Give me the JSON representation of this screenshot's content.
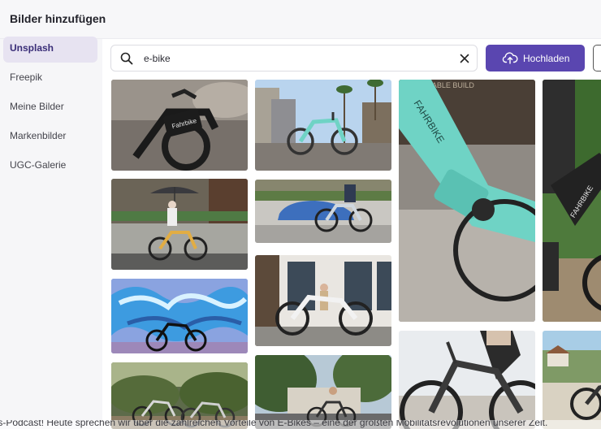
{
  "dialog": {
    "title": "Bilder hinzufügen"
  },
  "sidebar": {
    "items": [
      {
        "label": "Unsplash",
        "active": true
      },
      {
        "label": "Freepik"
      },
      {
        "label": "Meine Bilder"
      },
      {
        "label": "Markenbilder"
      },
      {
        "label": "UGC-Galerie"
      }
    ]
  },
  "search": {
    "value": "e-bike",
    "icon": "search-icon",
    "clear_icon": "close-icon"
  },
  "toolbar": {
    "upload_label": "Hochladen",
    "upload_icon": "cloud-upload-icon"
  },
  "gallery": {
    "images": [
      {
        "name": "black-ebike-closeup",
        "sign_text": "Fahrbike"
      },
      {
        "name": "mint-ebike-street-palms"
      },
      {
        "name": "mint-ebike-frame-closeup",
        "sign_text": "STABLE BUILD",
        "frame_text": "FAHRBIKE"
      },
      {
        "name": "rider-black-ebike-park",
        "frame_text": "FAHRBIKE"
      },
      {
        "name": "woman-yellow-ebike-umbrella"
      },
      {
        "name": "man-ebike-blue-car"
      },
      {
        "name": "ebike-graffiti-wall"
      },
      {
        "name": "woman-white-ebike-storefront"
      },
      {
        "name": "black-ebike-low-angle"
      },
      {
        "name": "rider-ebike-coastal-town"
      },
      {
        "name": "two-ebikes-hedge"
      },
      {
        "name": "ebike-tree-street"
      }
    ]
  },
  "caption": {
    "text": "ts-Podcast! Heute sprechen wir über die zahlreichen Vorteile von E-Bikes – eine der größten Mobilitätsrevolutionen unserer Zeit."
  },
  "colors": {
    "accent": "#5a46b0",
    "active_nav": "#e7e3f1",
    "mint_bike": "#6fd3c5"
  }
}
